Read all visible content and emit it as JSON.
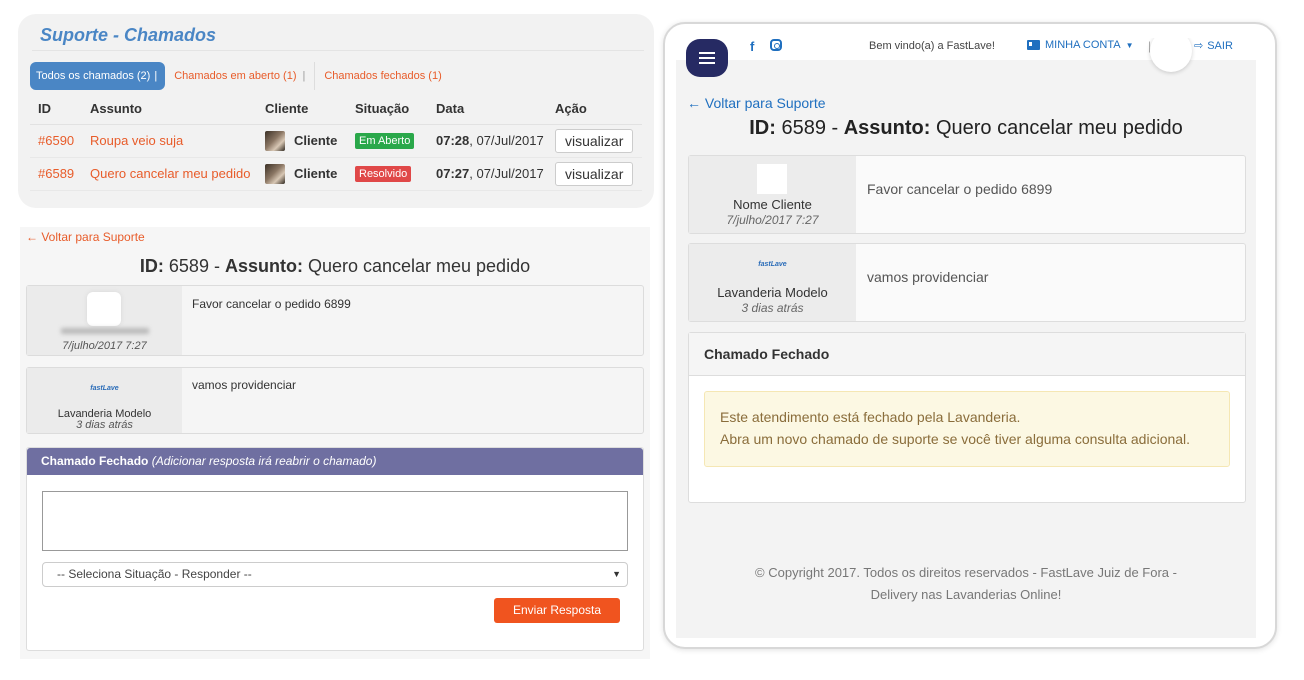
{
  "list": {
    "title": "Suporte - Chamados",
    "tabs": [
      {
        "label": "Todos os chamados (2)"
      },
      {
        "label": "Chamados em aberto (1)"
      },
      {
        "label": "Chamados fechados (1)"
      }
    ],
    "columns": [
      "ID",
      "Assunto",
      "Cliente",
      "Situação",
      "Data",
      "Ação"
    ],
    "rows": [
      {
        "id": "#6590",
        "subject": "Roupa veio suja",
        "client": "Cliente",
        "status": "Em Aberto",
        "time": "07:28",
        "date": ", 07/Jul/2017",
        "action": "visualizar"
      },
      {
        "id": "#6589",
        "subject": "Quero cancelar meu pedido",
        "client": "Cliente",
        "status": "Resolvido",
        "time": "07:27",
        "date": ", 07/Jul/2017",
        "action": "visualizar"
      }
    ]
  },
  "detail_left": {
    "back_link": "← Voltar para Suporte",
    "heading": {
      "id_label": "ID:",
      "id_value": " 6589 - ",
      "subject_label": "Assunto:",
      "subject_value": " Quero cancelar meu pedido"
    },
    "messages": [
      {
        "author": "",
        "date": "7/julho/2017 7:27",
        "text": "Favor cancelar o pedido 6899"
      },
      {
        "author": "Lavanderia Modelo",
        "logo": "fastLave",
        "date": "3 dias atrás",
        "text": "vamos providenciar"
      }
    ],
    "reply": {
      "title": "Chamado Fechado",
      "subtitle": "(Adicionar resposta irá reabrir o chamado)",
      "select_value": "-- Seleciona Situação - Responder --",
      "send_label": "Enviar Resposta"
    }
  },
  "mobile": {
    "welcome": "Bem vindo(a) a FastLave!",
    "account_label": "MINHA CONTA",
    "exit_label": "SAIR",
    "back_link": "← Voltar para Suporte",
    "heading": {
      "id_label": "ID:",
      "id_value": " 6589 - ",
      "subject_label": "Assunto:",
      "subject_value": " Quero cancelar meu pedido"
    },
    "messages": [
      {
        "author": "Nome Cliente",
        "date": "7/julho/2017 7:27",
        "text": "Favor cancelar o pedido 6899"
      },
      {
        "author": "Lavanderia Modelo",
        "logo": "fastLave",
        "date": "3 dias atrás",
        "text": "vamos providenciar"
      }
    ],
    "closed": {
      "title": "Chamado Fechado",
      "line1": "Este atendimento está fechado pela Lavanderia.",
      "line2": "Abra um novo chamado de suporte se você tiver alguma consulta adicional."
    },
    "footer": {
      "line1": "© Copyright 2017. Todos os direitos reservados - FastLave Juiz de Fora -",
      "line2": "Delivery nas Lavanderias Online!"
    },
    "icons": [
      "menu-icon",
      "facebook-icon",
      "instagram-icon",
      "account-card-icon",
      "exit-icon"
    ]
  },
  "colors": {
    "accent_blue": "#4a86c5",
    "link_orange": "#e85c2a",
    "status_open": "#2aa84a",
    "status_solved": "#e04848",
    "reply_header": "#6f6fa1",
    "send_button": "#f0541f",
    "menu_button": "#262a63",
    "mobile_link": "#1f6fbf"
  }
}
